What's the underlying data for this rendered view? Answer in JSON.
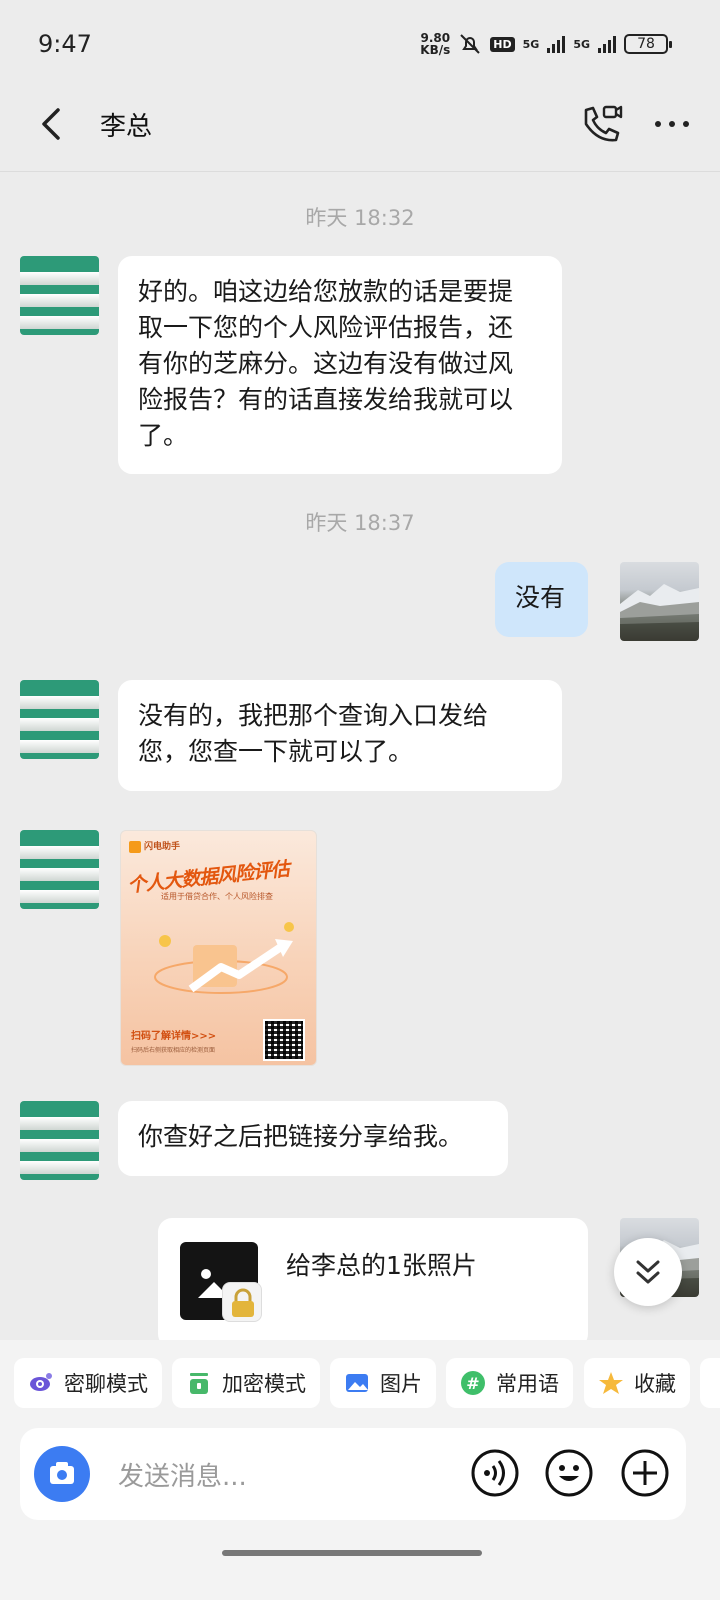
{
  "status_bar": {
    "time": "9:47",
    "net_speed_value": "9.80",
    "net_speed_unit": "KB/s",
    "hd_label": "HD",
    "signal1_label": "5G",
    "signal2_label": "5G",
    "battery": "78"
  },
  "header": {
    "title": "李总",
    "back_icon": "chevron-left-icon",
    "call_icon": "phone-video-icon",
    "more_icon": "more-dots-icon"
  },
  "messages": [
    {
      "type": "time",
      "text": "昨天 18:32"
    },
    {
      "type": "text",
      "side": "left",
      "lines": [
        "好的。咱这边给您放款的话是要提",
        "取一下您的个人风险评估报告，还",
        "有你的芝麻分。这边有没有做过风",
        "险报告？有的话直接发给我就可以",
        "了。"
      ]
    },
    {
      "type": "time",
      "text": "昨天 18:37"
    },
    {
      "type": "text",
      "side": "right",
      "text": "没有"
    },
    {
      "type": "text",
      "side": "left",
      "lines": [
        "没有的，我把那个查询入口发给",
        "您，您查一下就可以了。"
      ]
    },
    {
      "type": "image",
      "side": "left",
      "brand": "闪电助手",
      "title": "个人大数据风险评估",
      "subtitle": "适用于借贷合作、个人风险排查",
      "cta": "扫码了解详情>>>",
      "cta_small": "扫码后右侧获取相应的检测页面"
    },
    {
      "type": "text",
      "side": "left",
      "text": "你查好之后把链接分享给我。"
    },
    {
      "type": "card",
      "side": "right",
      "text": "给李总的1张照片"
    }
  ],
  "quick_actions": [
    {
      "label": "密聊模式",
      "icon": "eye-lock-icon"
    },
    {
      "label": "加密模式",
      "icon": "lock-icon"
    },
    {
      "label": "图片",
      "icon": "image-icon"
    },
    {
      "label": "常用语",
      "icon": "hash-icon"
    },
    {
      "label": "收藏",
      "icon": "star-icon"
    }
  ],
  "input": {
    "placeholder": "发送消息..."
  },
  "colors": {
    "accent": "#3c7cf2",
    "bubble_me": "#cfe6fb",
    "avatar_green": "#2d9a78"
  }
}
